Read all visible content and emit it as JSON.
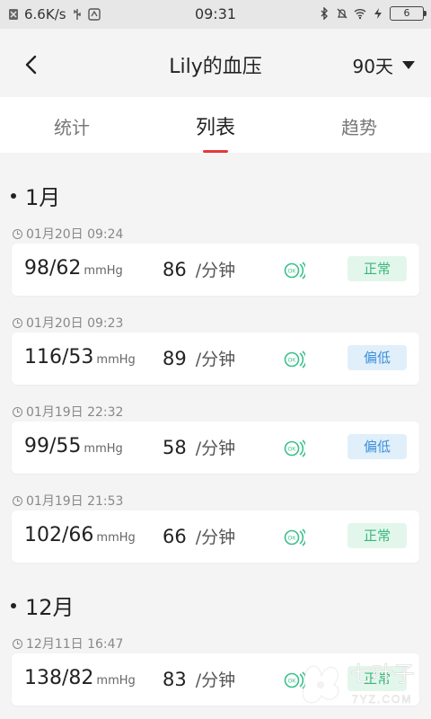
{
  "status_bar": {
    "speed": "6.6K/s",
    "time": "09:31",
    "battery": "6"
  },
  "header": {
    "title": "Lily的血压",
    "range": "90天"
  },
  "tabs": [
    {
      "label": "统计"
    },
    {
      "label": "列表"
    },
    {
      "label": "趋势"
    }
  ],
  "months": [
    {
      "label": "1月"
    },
    {
      "label": "12月"
    }
  ],
  "records": [
    {
      "time": "01月20日 09:24",
      "bp": "98/62",
      "unit": "mmHg",
      "pulse": "86",
      "pulse_unit": "/分钟",
      "status": "正常"
    },
    {
      "time": "01月20日 09:23",
      "bp": "116/53",
      "unit": "mmHg",
      "pulse": "89",
      "pulse_unit": "/分钟",
      "status": "偏低"
    },
    {
      "time": "01月19日 22:32",
      "bp": "99/55",
      "unit": "mmHg",
      "pulse": "58",
      "pulse_unit": "/分钟",
      "status": "偏低"
    },
    {
      "time": "01月19日 21:53",
      "bp": "102/66",
      "unit": "mmHg",
      "pulse": "66",
      "pulse_unit": "/分钟",
      "status": "正常"
    },
    {
      "time": "12月11日 16:47",
      "bp": "138/82",
      "unit": "mmHg",
      "pulse": "83",
      "pulse_unit": "/分钟",
      "status": "正常"
    }
  ],
  "watermark": {
    "brand": "七叶子",
    "domain": "7YZ.COM"
  },
  "colors": {
    "accent": "#e3393c",
    "normal_text": "#38b87a",
    "normal_bg": "#e3f6ec",
    "low_text": "#3a8fd8",
    "low_bg": "#e1effb",
    "ok_icon": "#3ac08a"
  },
  "icons": {
    "back": "chevron-left-icon",
    "range": "caret-down-icon",
    "time": "clock-icon",
    "status_check": "ok-check-icon"
  }
}
